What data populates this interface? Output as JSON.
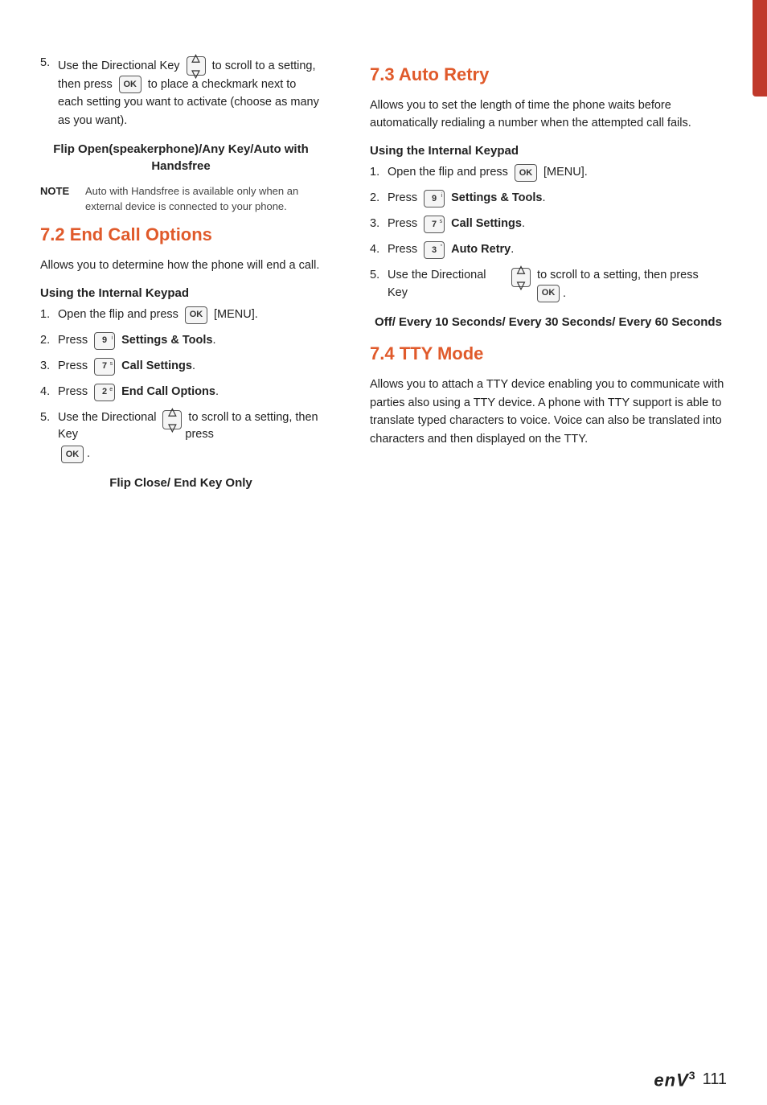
{
  "sidebar_tab": {
    "color": "#c0392b"
  },
  "left_column": {
    "intro_step": {
      "number": "5.",
      "text_before": "Use the Directional Key",
      "text_after": "to scroll to a setting, then press",
      "ok_key": "OK",
      "text_end": "to place a checkmark next to each setting you want to activate (choose as many as you want)."
    },
    "flip_subsection": {
      "title": "Flip Open(speakerphone)/Any Key/Auto with Handsfree"
    },
    "note": {
      "label": "NOTE",
      "text": "Auto with Handsfree is available only when an external device is connected to your phone."
    },
    "section_72": {
      "title": "7.2 End Call Options",
      "description": "Allows you to determine how the phone will end a call.",
      "subsection_title": "Using the Internal Keypad",
      "steps": [
        {
          "number": "1.",
          "text_before": "Open the flip and press",
          "key": "OK",
          "key_type": "ok",
          "text_after": "[MENU]."
        },
        {
          "number": "2.",
          "text_before": "Press",
          "key": "9",
          "key_superscript": "i",
          "key_type": "num",
          "text_after": "Settings & Tools."
        },
        {
          "number": "3.",
          "text_before": "Press",
          "key": "7",
          "key_superscript": "s",
          "key_type": "num",
          "text_after": "Call Settings."
        },
        {
          "number": "4.",
          "text_before": "Press",
          "key": "2",
          "key_superscript": "e",
          "key_type": "num",
          "text_after": "End Call Options."
        }
      ],
      "step5": {
        "number": "5.",
        "text1": "Use the Directional Key",
        "text2": "to scroll to a setting, then press",
        "text3": "."
      },
      "flip_result": {
        "text": "Flip Close/ End Key Only"
      }
    }
  },
  "right_column": {
    "section_73": {
      "title": "7.3 Auto Retry",
      "description": "Allows you to set the length of time the phone waits before automatically redialing a number when the attempted call fails.",
      "subsection_title": "Using the Internal Keypad",
      "steps": [
        {
          "number": "1.",
          "text_before": "Open the flip and press",
          "key": "OK",
          "key_type": "ok",
          "text_after": "[MENU]."
        },
        {
          "number": "2.",
          "text_before": "Press",
          "key": "9",
          "key_superscript": "i",
          "key_type": "num",
          "text_after": "Settings & Tools."
        },
        {
          "number": "3.",
          "text_before": "Press",
          "key": "7",
          "key_superscript": "s",
          "key_type": "num",
          "text_after": "Call Settings."
        },
        {
          "number": "4.",
          "text_before": "Press",
          "key": "3",
          "key_superscript": "\"",
          "key_type": "num",
          "text_after": "Auto Retry."
        }
      ],
      "step5": {
        "number": "5.",
        "text1": "Use the Directional Key",
        "text2": "to scroll to a setting, then press",
        "text3": "."
      },
      "options_result": {
        "text": "Off/ Every 10 Seconds/ Every 30 Seconds/ Every 60 Seconds"
      }
    },
    "section_74": {
      "title": "7.4 TTY Mode",
      "description": "Allows you to attach a TTY device enabling you to communicate with parties also using a TTY device. A phone with TTY support is able to translate typed characters to voice. Voice can also be translated into characters and then displayed on the TTY."
    }
  },
  "footer": {
    "brand": "enV",
    "version": "3",
    "page_number": "111"
  }
}
